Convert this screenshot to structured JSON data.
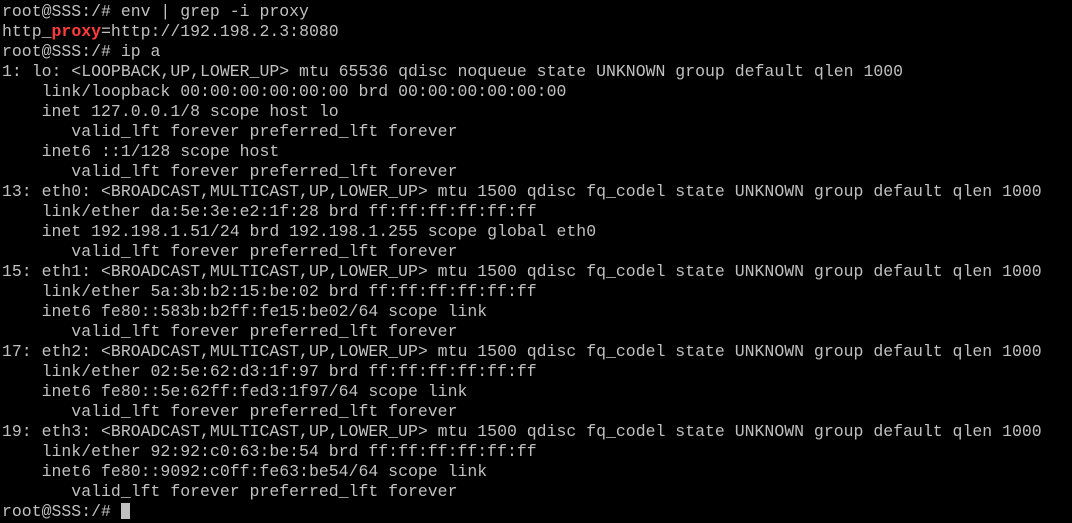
{
  "colors": {
    "background": "#000000",
    "foreground": "#c0c0c0",
    "match_highlight": "#ff3b3b"
  },
  "terminal": {
    "lines": [
      "root@SSS:/# env | grep -i proxy",
      {
        "prefix": "http_",
        "match": "proxy",
        "suffix": "=http://192.198.2.3:8080"
      },
      "root@SSS:/# ip a",
      "1: lo: <LOOPBACK,UP,LOWER_UP> mtu 65536 qdisc noqueue state UNKNOWN group default qlen 1000",
      "    link/loopback 00:00:00:00:00:00 brd 00:00:00:00:00:00",
      "    inet 127.0.0.1/8 scope host lo",
      "       valid_lft forever preferred_lft forever",
      "    inet6 ::1/128 scope host",
      "       valid_lft forever preferred_lft forever",
      "13: eth0: <BROADCAST,MULTICAST,UP,LOWER_UP> mtu 1500 qdisc fq_codel state UNKNOWN group default qlen 1000",
      "    link/ether da:5e:3e:e2:1f:28 brd ff:ff:ff:ff:ff:ff",
      "    inet 192.198.1.51/24 brd 192.198.1.255 scope global eth0",
      "       valid_lft forever preferred_lft forever",
      "15: eth1: <BROADCAST,MULTICAST,UP,LOWER_UP> mtu 1500 qdisc fq_codel state UNKNOWN group default qlen 1000",
      "    link/ether 5a:3b:b2:15:be:02 brd ff:ff:ff:ff:ff:ff",
      "    inet6 fe80::583b:b2ff:fe15:be02/64 scope link",
      "       valid_lft forever preferred_lft forever",
      "17: eth2: <BROADCAST,MULTICAST,UP,LOWER_UP> mtu 1500 qdisc fq_codel state UNKNOWN group default qlen 1000",
      "    link/ether 02:5e:62:d3:1f:97 brd ff:ff:ff:ff:ff:ff",
      "    inet6 fe80::5e:62ff:fed3:1f97/64 scope link",
      "       valid_lft forever preferred_lft forever",
      "19: eth3: <BROADCAST,MULTICAST,UP,LOWER_UP> mtu 1500 qdisc fq_codel state UNKNOWN group default qlen 1000",
      "    link/ether 92:92:c0:63:be:54 brd ff:ff:ff:ff:ff:ff",
      "    inet6 fe80::9092:c0ff:fe63:be54/64 scope link",
      "       valid_lft forever preferred_lft forever",
      "root@SSS:/# "
    ],
    "cursor_visible": true
  }
}
